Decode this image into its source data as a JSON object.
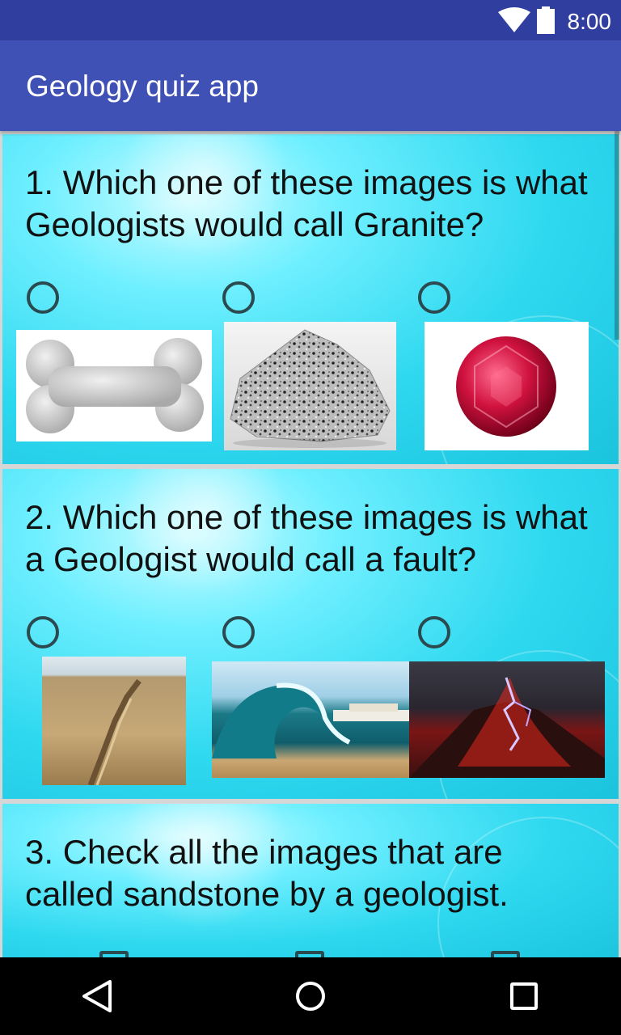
{
  "status_bar": {
    "time": "8:00"
  },
  "app": {
    "title": "Geology quiz app"
  },
  "questions": [
    {
      "text": "1. Which one of these images is what Geologists would call Granite?",
      "input_type": "radio",
      "options": [
        {
          "image": "bone"
        },
        {
          "image": "granite-rock"
        },
        {
          "image": "red-gemstone"
        }
      ]
    },
    {
      "text": "2. Which one of these images is what a Geologist would call a fault?",
      "input_type": "radio",
      "options": [
        {
          "image": "fault-line-landscape"
        },
        {
          "image": "ocean-wave-beach"
        },
        {
          "image": "volcano-lightning"
        }
      ]
    },
    {
      "text": "3. Check all the images that are called sandstone by a geologist.",
      "input_type": "checkbox",
      "options": [
        {
          "image": ""
        },
        {
          "image": ""
        },
        {
          "image": ""
        }
      ]
    }
  ],
  "colors": {
    "status_bar": "#303f9f",
    "app_bar": "#3f51b5",
    "card": "#2ed8ef",
    "nav_bar": "#000000"
  }
}
